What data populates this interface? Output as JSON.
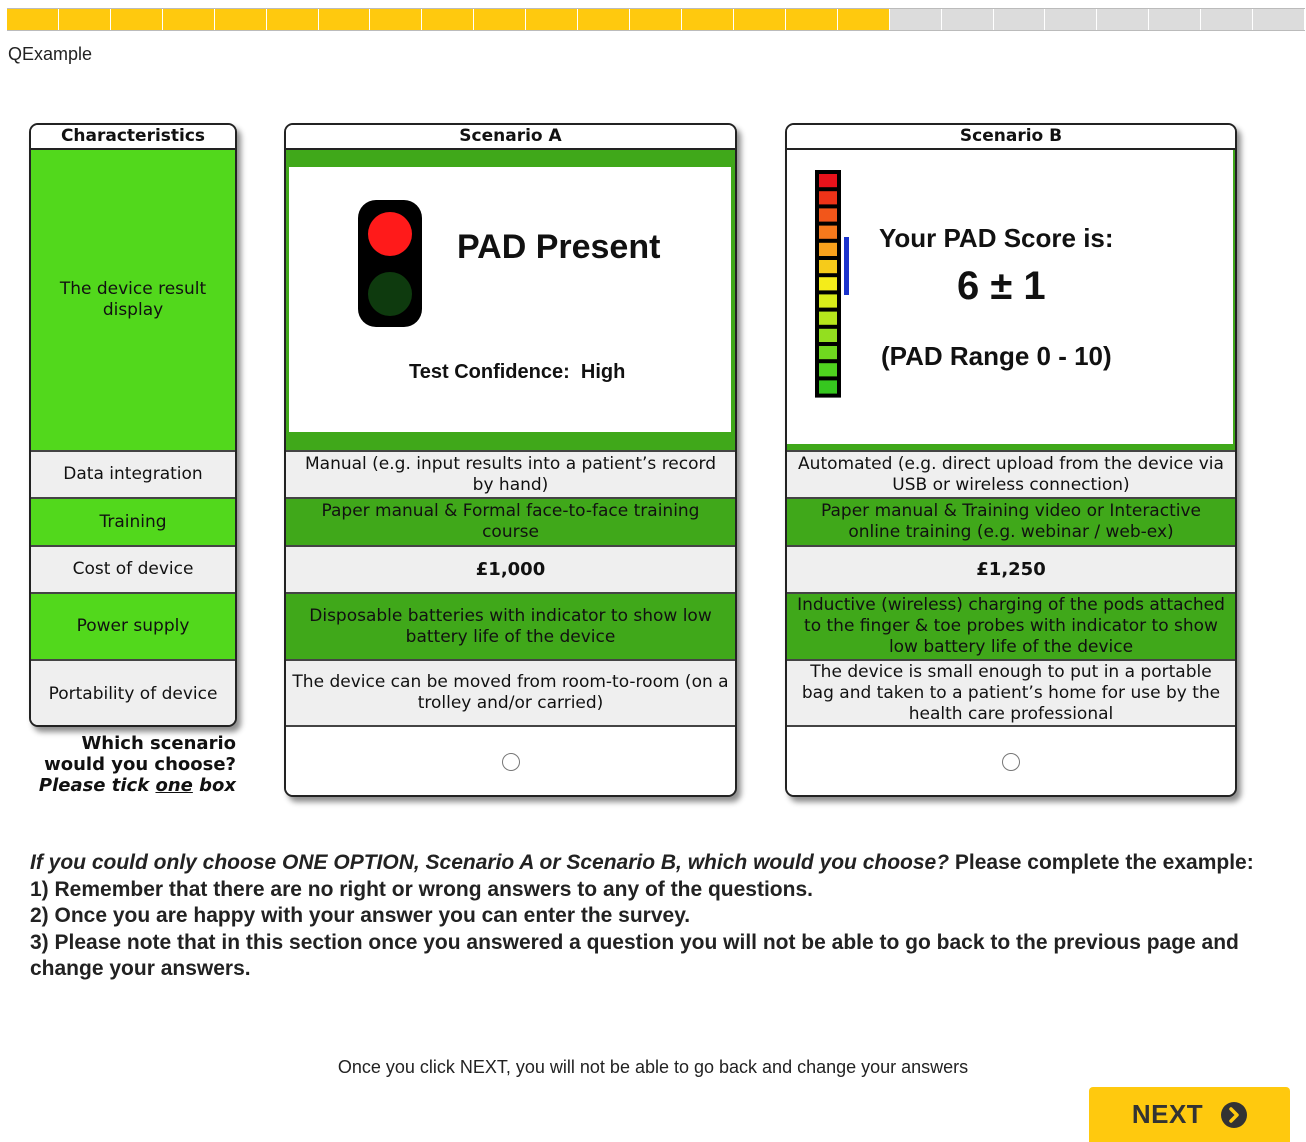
{
  "progress": {
    "completed_segments": 17,
    "total_segments": 25
  },
  "page": {
    "title": "QExample"
  },
  "characteristics": {
    "header": "Characteristics",
    "rows": [
      "The device result display",
      "Data integration",
      "Training",
      "Cost of device",
      "Power supply",
      "Portability of device"
    ]
  },
  "scenario_a": {
    "header": "Scenario A",
    "display": {
      "headline": "PAD Present",
      "confidence_label": "Test Confidence:",
      "confidence_value": "High"
    },
    "data_integration": "Manual (e.g. input results into a patient’s record by hand)",
    "training": "Paper manual & Formal face-to-face training course",
    "cost": "£1,000",
    "power_supply": "Disposable batteries with indicator to show low battery life of the device",
    "portability": "The device can be moved from room-to-room (on a trolley and/or carried)"
  },
  "scenario_b": {
    "header": "Scenario B",
    "display": {
      "heading": "Your PAD Score is:",
      "score": "6 ± 1",
      "range": "(PAD Range 0 - 10)"
    },
    "data_integration": "Automated (e.g. direct upload from the device via USB or wireless connection)",
    "training": "Paper manual & Training video or Interactive online training (e.g. webinar / web-ex)",
    "cost": "£1,250",
    "power_supply": "Inductive (wireless) charging of the pods attached to the finger & toe probes with indicator to show low battery life of the device",
    "portability": "The device is small enough to put in a portable bag and taken to a patient’s home for use by the health care professional"
  },
  "choice_prompt": {
    "line1": "Which scenario",
    "line2": "would you choose?",
    "line3_pre": "Please tick ",
    "line3_u": "one",
    "line3_post": " box"
  },
  "instructions": {
    "question": "If you could only choose ONE OPTION, Scenario A or Scenario B, which would you choose?",
    "question_tail": " Please complete the example:",
    "items": [
      "1) Remember that there are no right or wrong answers to any of the questions.",
      "2) Once you are happy with your answer you can enter the survey.",
      "3) Please note that in this section once you answered a question you will not be able to go back to the previous page and change your answers."
    ]
  },
  "footer_note": "Once you click NEXT, you will not be able to go back and change your answers",
  "next_button": {
    "label": "NEXT"
  },
  "colors": {
    "progress_fill": "#ffc90e",
    "progress_empty": "#dcdcdc",
    "attribute_green": "#52d81c",
    "scenario_green": "#40a81a",
    "traffic_red": "#ff1a1a",
    "score_marker": "#1a33cc"
  }
}
